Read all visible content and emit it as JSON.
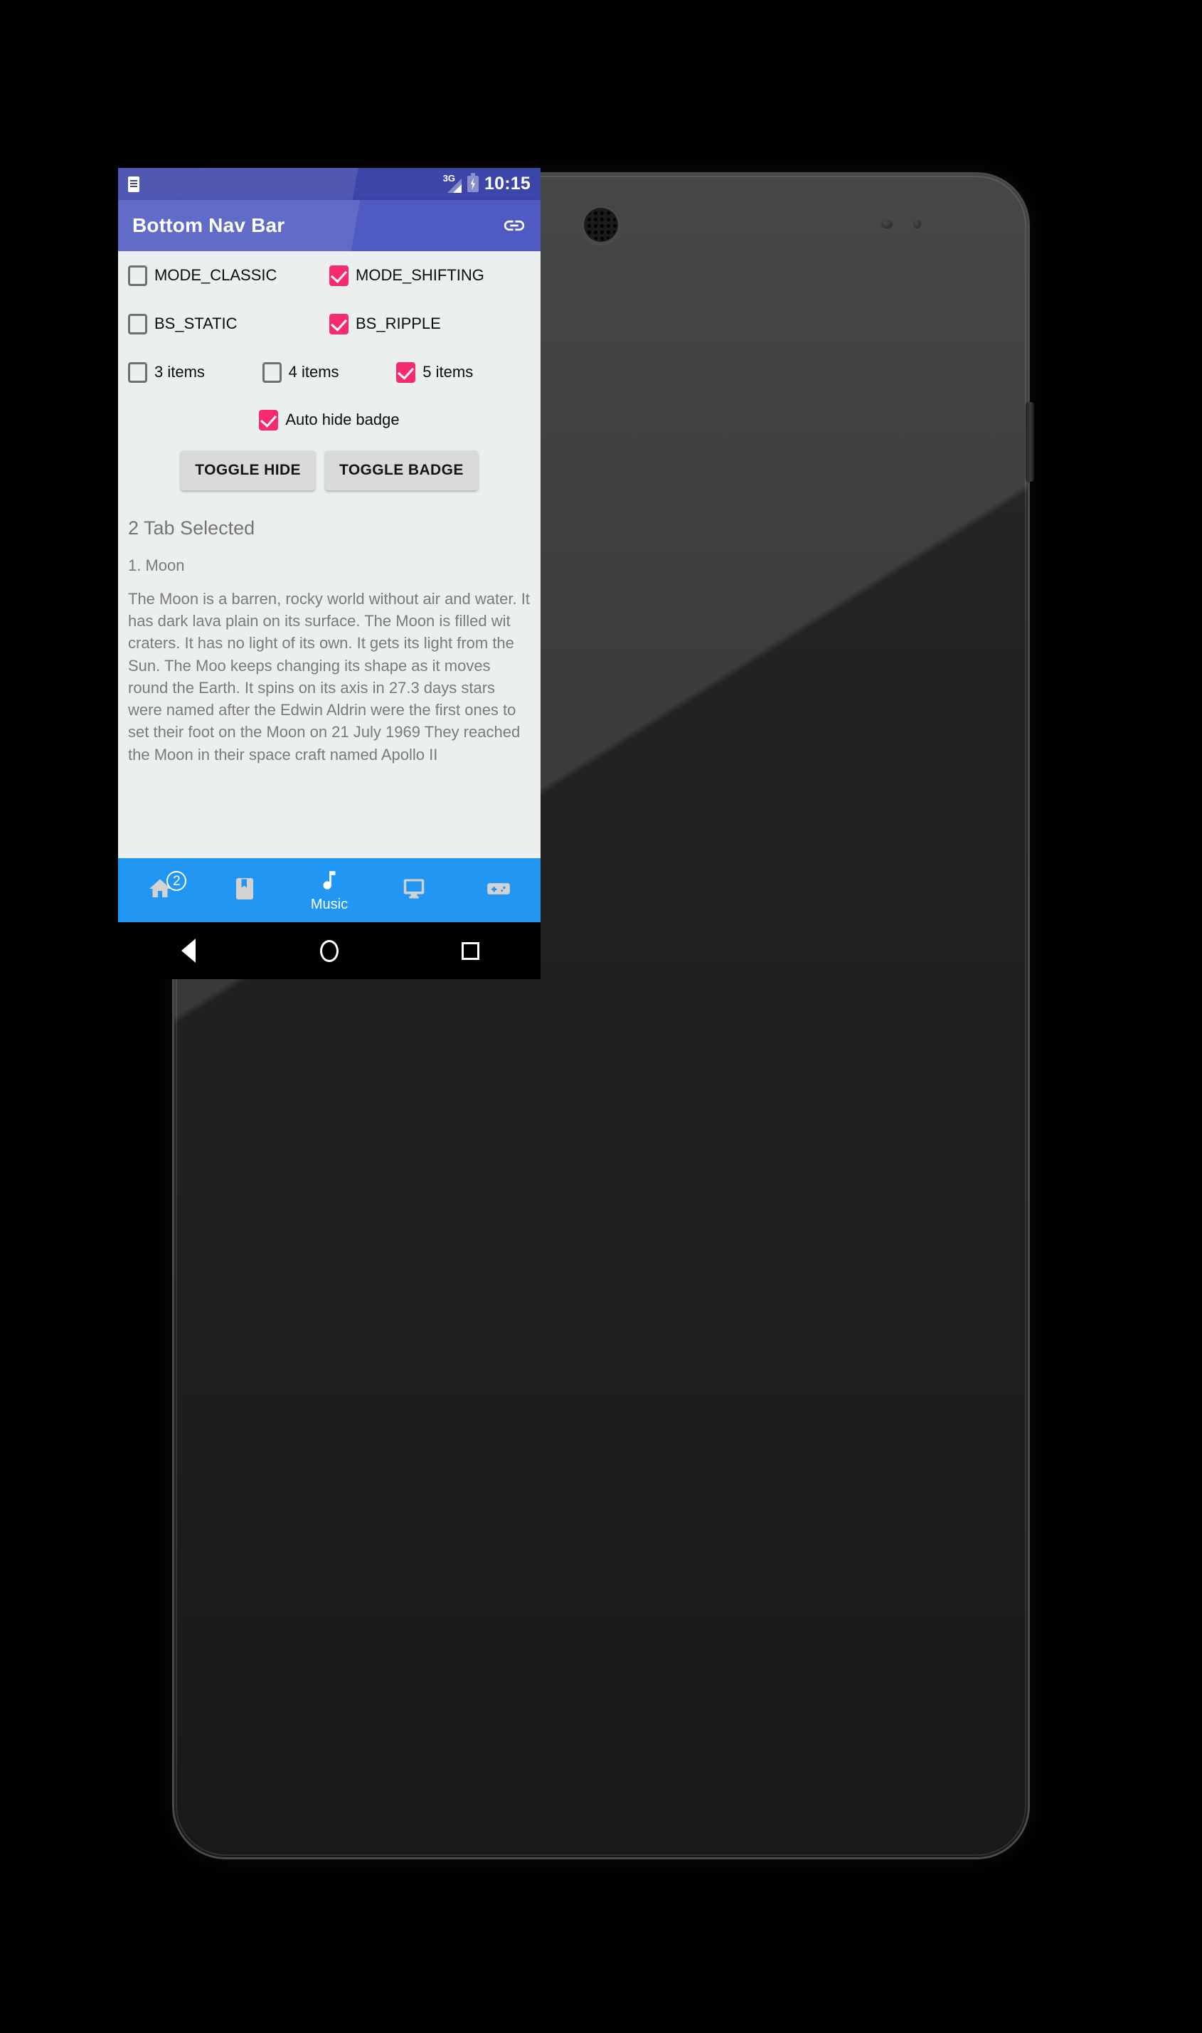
{
  "status_bar": {
    "notification_icon": "document-icon",
    "network": "3G",
    "battery_icon": "battery-charging-icon",
    "time": "10:15"
  },
  "app_bar": {
    "title": "Bottom Nav Bar",
    "action_icon": "link-icon"
  },
  "colors": {
    "status_bar": "#3c45a8",
    "app_bar": "#4f5ac2",
    "bottom_nav": "#2196f3",
    "checkbox_checked": "#f72a6d",
    "checkbox_unchecked": "#6f6f6f",
    "content_background": "#eceff0",
    "button_background": "#d9dbdb",
    "body_text": "#7a7a7a"
  },
  "checkboxes": {
    "row1": [
      {
        "label": "MODE_CLASSIC",
        "checked": false
      },
      {
        "label": "MODE_SHIFTING",
        "checked": true
      }
    ],
    "row2": [
      {
        "label": "BS_STATIC",
        "checked": false
      },
      {
        "label": "BS_RIPPLE",
        "checked": true
      }
    ],
    "row3": [
      {
        "label": "3 items",
        "checked": false
      },
      {
        "label": "4 items",
        "checked": false
      },
      {
        "label": "5 items",
        "checked": true
      }
    ],
    "row4": [
      {
        "label": "Auto hide badge",
        "checked": true
      }
    ]
  },
  "buttons": {
    "toggle_hide": "TOGGLE HIDE",
    "toggle_badge": "TOGGLE BADGE"
  },
  "main": {
    "tab_status": "2 Tab Selected",
    "article_title": "1. Moon",
    "article_body": "The Moon is a barren, rocky world without air and water. It has dark lava plain on its surface. The Moon is filled wit craters. It has no light of its own. It gets its light from the Sun. The Moo keeps changing its shape as it moves round the Earth. It spins on its axis in 27.3 days stars were named after the Edwin Aldrin were the first ones to set their foot on the Moon on 21 July 1969 They reached the Moon in their space craft named Apollo II"
  },
  "bottom_nav": {
    "items": [
      {
        "icon": "home-icon",
        "label": "",
        "active": false,
        "badge": "2"
      },
      {
        "icon": "book-icon",
        "label": "",
        "active": false,
        "badge": ""
      },
      {
        "icon": "music-icon",
        "label": "Music",
        "active": true,
        "badge": ""
      },
      {
        "icon": "monitor-icon",
        "label": "",
        "active": false,
        "badge": ""
      },
      {
        "icon": "gamepad-icon",
        "label": "",
        "active": false,
        "badge": ""
      }
    ]
  },
  "android_nav": {
    "back": "back-icon",
    "home": "home-circle-icon",
    "recents": "recents-square-icon"
  }
}
